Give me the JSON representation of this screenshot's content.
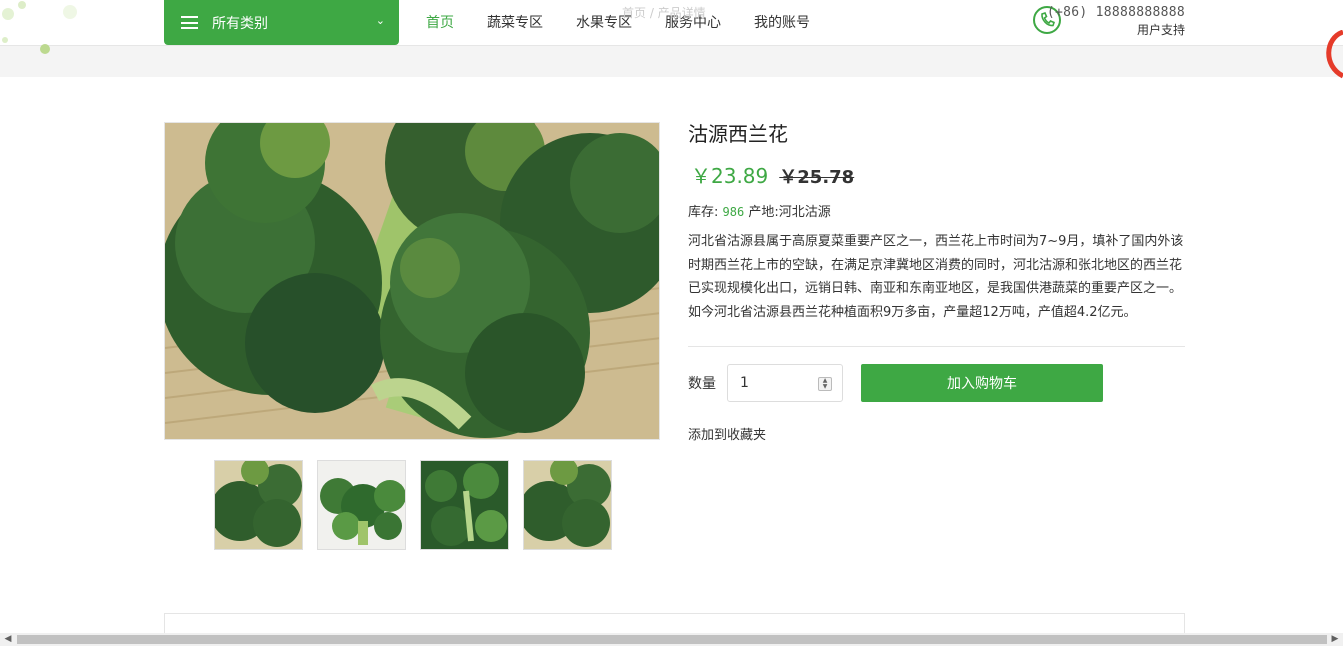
{
  "header": {
    "category_label": "所有类别",
    "nav": [
      "首页",
      "蔬菜专区",
      "水果专区",
      "服务中心",
      "我的账号"
    ],
    "active_index": 0,
    "breadcrumb_ghost": "首页  /  产品详情",
    "phone": "(+86) 18888888888",
    "support_label": "用户支持"
  },
  "product": {
    "title": "沽源西兰花",
    "price": "￥23.89",
    "original_price": "￥25.78",
    "stock_label": "库存:",
    "stock": "986",
    "origin_label": "产地:",
    "origin": "河北沽源",
    "description": "河北省沽源县属于高原夏菜重要产区之一，西兰花上市时间为7~9月，填补了国内外该时期西兰花上市的空缺，在满足京津冀地区消费的同时，河北沽源和张北地区的西兰花已实现规模化出口，远销日韩、南亚和东南亚地区，是我国供港蔬菜的重要产区之一。如今河北省沽源县西兰花种植面积9万多亩，产量超12万吨，产值超4.2亿元。",
    "quantity_label": "数量",
    "quantity": "1",
    "add_to_cart": "加入购物车",
    "add_to_favorites": "添加到收藏夹"
  },
  "colors": {
    "accent": "#3ea844",
    "text": "#333333",
    "border": "#e5e5e5"
  },
  "icons": [
    "menu-icon",
    "chevron-down-icon",
    "phone-icon",
    "spinner-icon"
  ]
}
